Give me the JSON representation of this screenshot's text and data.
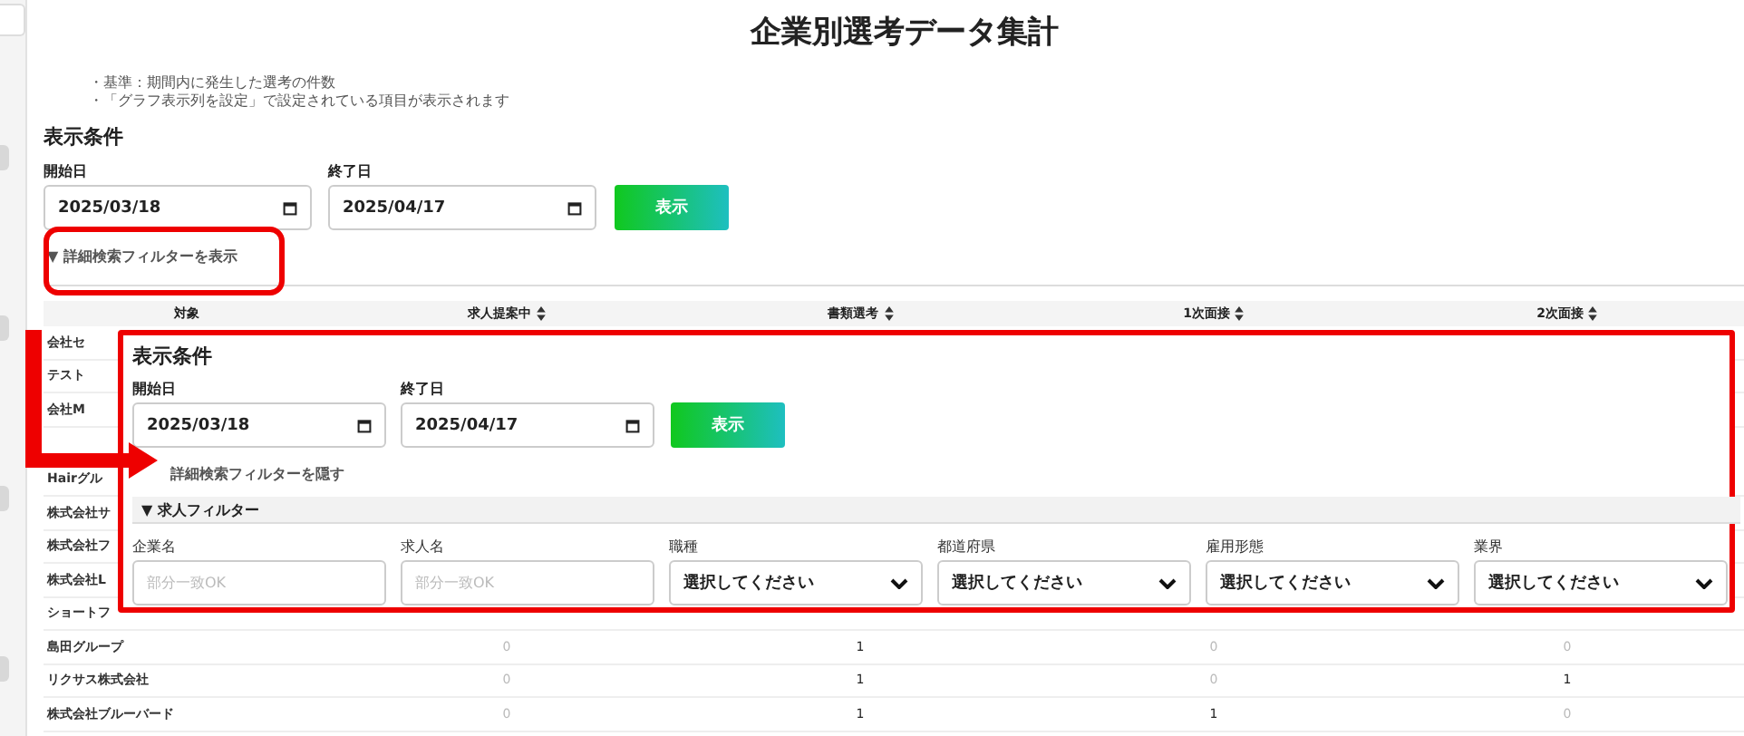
{
  "page_title": "企業別選考データ集計",
  "notes": [
    "・基準：期間内に発生した選考の件数",
    "・「グラフ表示列を設定」で設定されている項目が表示されます"
  ],
  "conditions": {
    "heading": "表示条件",
    "start_label": "開始日",
    "start_value": "2025/03/18",
    "end_label": "終了日",
    "end_value": "2025/04/17",
    "button": "表示",
    "filter_toggle": "▼ 詳細検索フィルターを表示"
  },
  "table": {
    "columns": [
      {
        "label": "対象",
        "sortable": false
      },
      {
        "label": "求人提案中",
        "sortable": true
      },
      {
        "label": "書類選考",
        "sortable": true
      },
      {
        "label": "1次面接",
        "sortable": true
      },
      {
        "label": "2次面接",
        "sortable": true
      }
    ],
    "rows": [
      {
        "cells": [
          "会社セ"
        ]
      },
      {
        "cells": [
          "テスト"
        ]
      },
      {
        "cells": [
          "会社M"
        ]
      },
      {
        "cells": [
          "Hairグル"
        ]
      },
      {
        "cells": [
          "株式会社サ"
        ]
      },
      {
        "cells": [
          "株式会社フ"
        ]
      },
      {
        "cells": [
          "株式会社L"
        ]
      },
      {
        "cells": [
          "ショートフ"
        ]
      },
      {
        "cells": [
          "島田グループ",
          "0",
          "1",
          "0",
          "0"
        ]
      },
      {
        "cells": [
          "リクサス株式会社",
          "0",
          "1",
          "0",
          "1"
        ]
      },
      {
        "cells": [
          "株式会社ブルーバード",
          "0",
          "1",
          "1",
          "0"
        ]
      }
    ]
  },
  "overlay_panel": {
    "heading": "表示条件",
    "start_label": "開始日",
    "start_value": "2025/03/18",
    "end_label": "終了日",
    "end_value": "2025/04/17",
    "button": "表示",
    "filter_toggle": "詳細検索フィルターを隠す",
    "section": "▼ 求人フィルター",
    "filters": [
      {
        "label": "企業名",
        "kind": "text",
        "placeholder": "部分一致OK"
      },
      {
        "label": "求人名",
        "kind": "text",
        "placeholder": "部分一致OK"
      },
      {
        "label": "職種",
        "kind": "select",
        "value": "選択してください"
      },
      {
        "label": "都道府県",
        "kind": "select",
        "value": "選択してください"
      },
      {
        "label": "雇用形態",
        "kind": "select",
        "value": "選択してください"
      },
      {
        "label": "業界",
        "kind": "select",
        "value": "選択してください"
      }
    ]
  }
}
